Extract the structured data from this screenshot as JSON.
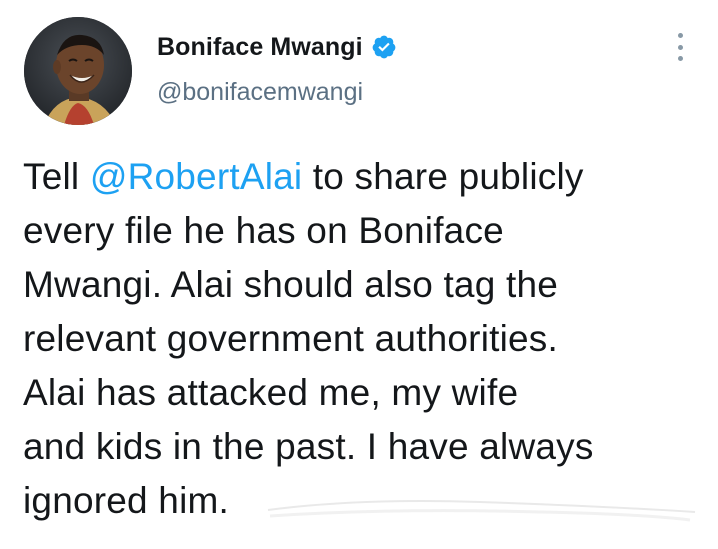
{
  "tweet": {
    "author": {
      "display_name": "Boniface Mwangi",
      "handle": "@bonifacemwangi",
      "verified": true,
      "avatar_icon": "profile-photo-avatar"
    },
    "menu_icon": "more-vertical-icon",
    "text_lines": [
      {
        "before": "Tell ",
        "mention": "@RobertAlai",
        "after": " to share publicly"
      },
      {
        "text": "every file he has on Boniface"
      },
      {
        "text": "Mwangi. Alai should also tag the"
      },
      {
        "text": "relevant government authorities."
      },
      {
        "text": "Alai has attacked me, my wife"
      },
      {
        "text": "and kids in the past. I have always"
      },
      {
        "text": "ignored him."
      }
    ],
    "colors": {
      "mention": "#1da1f2",
      "verified_badge": "#1da1f2",
      "secondary_text": "#5b7083",
      "primary_text": "#14171a"
    }
  }
}
